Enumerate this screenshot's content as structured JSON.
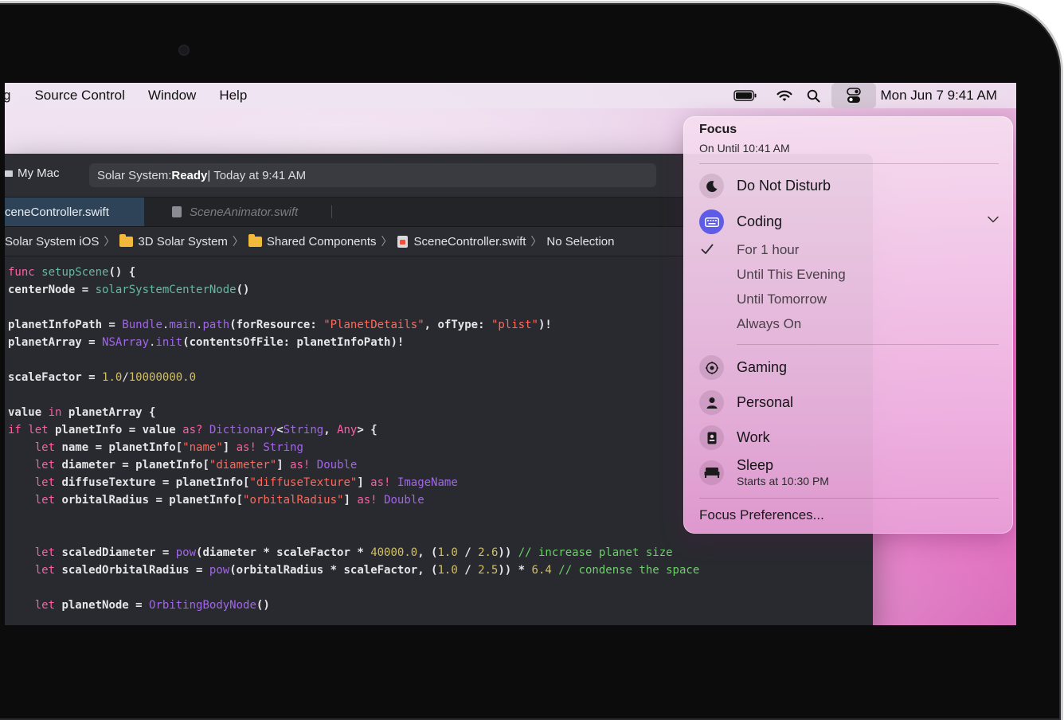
{
  "menubar": {
    "items": [
      "g",
      "Source Control",
      "Window",
      "Help"
    ],
    "clock": "Mon Jun 7  9:41 AM",
    "status_icons": [
      "battery-icon",
      "wifi-icon",
      "search-icon",
      "control-center-icon"
    ]
  },
  "xcode": {
    "run_destination": "My Mac",
    "activity": {
      "project": "Solar System: ",
      "status": "Ready",
      "time": " | Today at 9:41 AM"
    },
    "tabs": [
      {
        "label": "ceneController.swift",
        "active": true
      },
      {
        "label": "SceneAnimator.swift",
        "active": false
      }
    ],
    "breadcrumbs": [
      "Solar System iOS",
      "3D Solar System",
      "Shared Components",
      "SceneController.swift",
      "No Selection"
    ]
  },
  "focus": {
    "title": "Focus",
    "subtitle": "On Until 10:41 AM",
    "do_not_disturb": "Do Not Disturb",
    "coding": "Coding",
    "options": [
      "For 1 hour",
      "Until This Evening",
      "Until Tomorrow",
      "Always On"
    ],
    "gaming": "Gaming",
    "personal": "Personal",
    "work": "Work",
    "sleep": "Sleep",
    "sleep_sub": "Starts at 10:30 PM",
    "preferences": "Focus Preferences...",
    "accent_color": "#5e5ce6"
  }
}
